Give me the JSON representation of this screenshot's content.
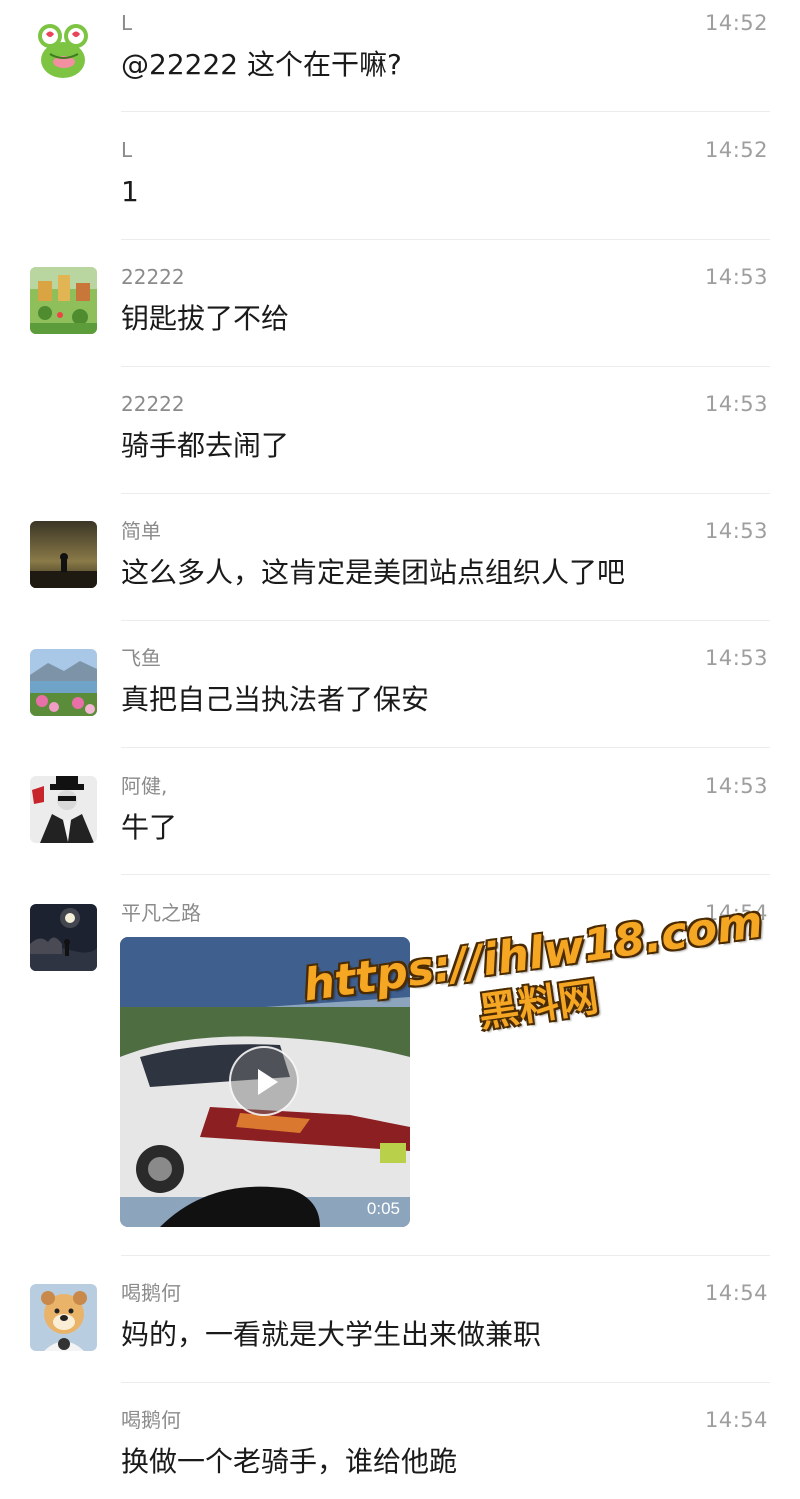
{
  "messages": [
    {
      "sender": "L",
      "time": "14:52",
      "text": "@22222 这个在干嘛?",
      "avatar": "frog-avatar"
    },
    {
      "sender": "L",
      "time": "14:52",
      "text": "1"
    },
    {
      "sender": "22222",
      "time": "14:53",
      "text": "钥匙拔了不给",
      "avatar": "landscape-painting-avatar"
    },
    {
      "sender": "22222",
      "time": "14:53",
      "text": "骑手都去闹了"
    },
    {
      "sender": "简单",
      "time": "14:53",
      "text": "这么多人，这肯定是美团站点组织人了吧",
      "avatar": "silhouette-dusk-avatar"
    },
    {
      "sender": "飞鱼",
      "time": "14:53",
      "text": "真把自己当执法者了保安",
      "avatar": "lake-flowers-avatar"
    },
    {
      "sender": "阿健,",
      "time": "14:53",
      "text": "牛了",
      "avatar": "man-in-hat-avatar"
    },
    {
      "sender": "平凡之路",
      "time": "14:54",
      "video_duration": "0:05",
      "avatar": "night-moon-avatar"
    },
    {
      "sender": "喝鹅何",
      "time": "14:54",
      "text": "妈的，一看就是大学生出来做兼职",
      "avatar": "dog-avatar"
    },
    {
      "sender": "喝鹅何",
      "time": "14:54",
      "text": "换做一个老骑手，谁给他跪"
    }
  ],
  "watermark": {
    "url": "https://ihlw18.com",
    "name": "黑料网"
  },
  "colors": {
    "sender": "#8b8b8b",
    "time": "#9e9e9e",
    "text": "#1a1a1a",
    "divider": "#ececec",
    "watermark": "#f5a623"
  }
}
